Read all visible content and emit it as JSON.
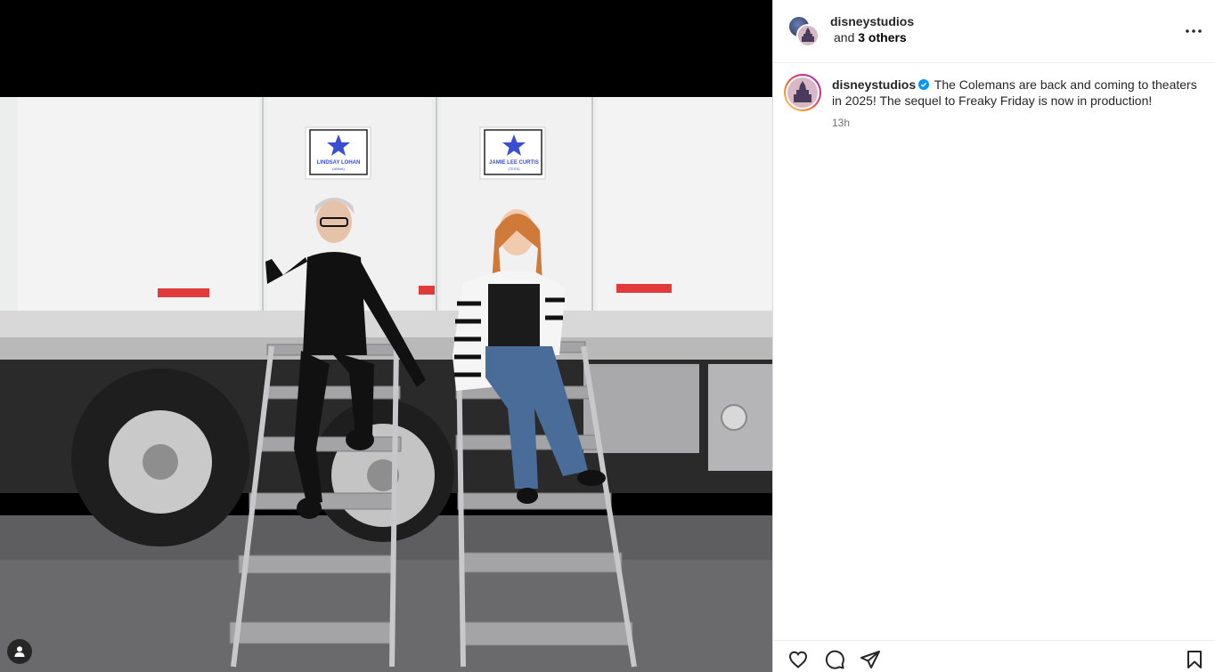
{
  "post": {
    "author": "disneystudios",
    "collaborators_label": "and",
    "collaborators_count": "3 others",
    "caption": "The Colemans are back and coming to theaters in 2025! The sequel to Freaky Friday is now in production!",
    "time": "13h"
  },
  "photo": {
    "sign_left_name": "LINDSAY LOHAN",
    "sign_left_role": "(ANNA)",
    "sign_right_name": "JAMIE LEE CURTIS",
    "sign_right_role": "(TESS)"
  },
  "icons": {
    "more": "more-options-icon",
    "like": "heart-icon",
    "comment": "comment-icon",
    "share": "send-icon",
    "save": "bookmark-icon",
    "tags": "user-tag-icon",
    "verified": "verified-badge-icon"
  },
  "colors": {
    "verified": "#0095f6",
    "story_ring": [
      "#feda75",
      "#fa7e1e",
      "#d62976",
      "#962fbf"
    ],
    "sign_star": "#3a4fd0"
  }
}
